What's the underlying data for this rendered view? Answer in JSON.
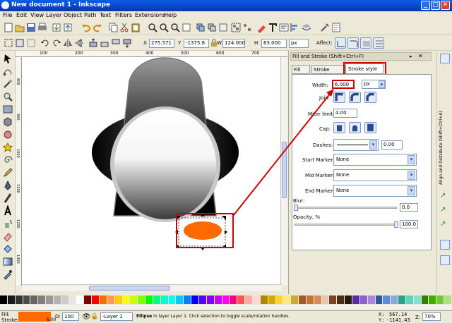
{
  "window": {
    "title": "New document 1 - Inkscape",
    "min": "_",
    "max": "□",
    "close": "✕"
  },
  "menu": [
    "File",
    "Edit",
    "View",
    "Layer",
    "Object",
    "Path",
    "Text",
    "Filters",
    "Extensions",
    "Help"
  ],
  "toolctrl": {
    "x_label": "X",
    "x": "275.571",
    "y_label": "Y",
    "y": "-1375.8",
    "w_label": "W",
    "w": "124.000",
    "h_label": "H",
    "h": "63.000",
    "unit": "px",
    "affect": "Affect:"
  },
  "ruler_top": [
    "100",
    "200",
    "300",
    "400",
    "500",
    "600",
    "700"
  ],
  "ruler_left": [
    "800",
    "900",
    "1000",
    "1100",
    "1200",
    "1300"
  ],
  "dialog": {
    "title": "Fill and Stroke (Shift+Ctrl+F)",
    "tab_fill": "Fill",
    "tab_stroke_paint": "Stroke paint",
    "tab_stroke_style": "Stroke style",
    "width_label": "Width:",
    "width": "6.000",
    "width_unit": "px",
    "join_label": "Join:",
    "miter_label": "Miter limit:",
    "miter": "4.00",
    "cap_label": "Cap:",
    "dashes_label": "Dashes:",
    "dashes_value": "0.00",
    "start_markers_label": "Start Markers:",
    "start_markers": "None",
    "mid_markers_label": "Mid Markers:",
    "mid_markers": "None",
    "end_markers_label": "End Markers:",
    "end_markers": "None",
    "blur_label": "Blur:",
    "blur": "0.0",
    "opacity_label": "Opacity, %",
    "opacity": "100.0"
  },
  "right_panel_title": "Align and Distribute (Shift+Ctrl+A)",
  "status": {
    "fill_label": "Fill:",
    "stroke_label": "Stroke:",
    "stroke_width": "6.00",
    "opacity_label": "O:",
    "opacity": "100",
    "layer": "-Layer 1",
    "message_bold": "Ellipse",
    "message": " in layer Layer 1. Click selection to toggle scale/rotation handles.",
    "x_label": "X:",
    "x": "567.14",
    "y_label": "Y:",
    "y": "-1141.43",
    "zoom_label": "Z:",
    "zoom": "70%"
  },
  "colors": {
    "selected_fill": "#ff6a00",
    "accent": "#cc0000",
    "palette": [
      "#000000",
      "#1a1a1a",
      "#333333",
      "#4d4d4d",
      "#666666",
      "#808080",
      "#999999",
      "#b3b3b3",
      "#cccccc",
      "#e6e6e6",
      "#ffffff",
      "#800000",
      "#ff0000",
      "#ff6a00",
      "#ff9955",
      "#ffcc00",
      "#ffff00",
      "#ccff00",
      "#80ff00",
      "#00ff00",
      "#00ff80",
      "#00ffcc",
      "#00ffff",
      "#00ccff",
      "#0080ff",
      "#0000ff",
      "#5500ff",
      "#8000ff",
      "#cc00ff",
      "#ff00ff",
      "#ff0080",
      "#ff5555",
      "#ffaaaa",
      "#ffd5d5",
      "#aa8800",
      "#d4aa00",
      "#ffd42a",
      "#ffe680",
      "#c8ab37",
      "#a05a2c",
      "#c87137",
      "#d38d5f",
      "#e9c6af",
      "#784421",
      "#502d16",
      "#28170b",
      "#5a2ca0",
      "#8d5fd3",
      "#aa87de",
      "#2c5aa0",
      "#5f8dd3",
      "#87aade",
      "#2ca089",
      "#5fd3bc",
      "#87decd",
      "#338000",
      "#44aa00",
      "#71c837",
      "#aade87"
    ]
  }
}
